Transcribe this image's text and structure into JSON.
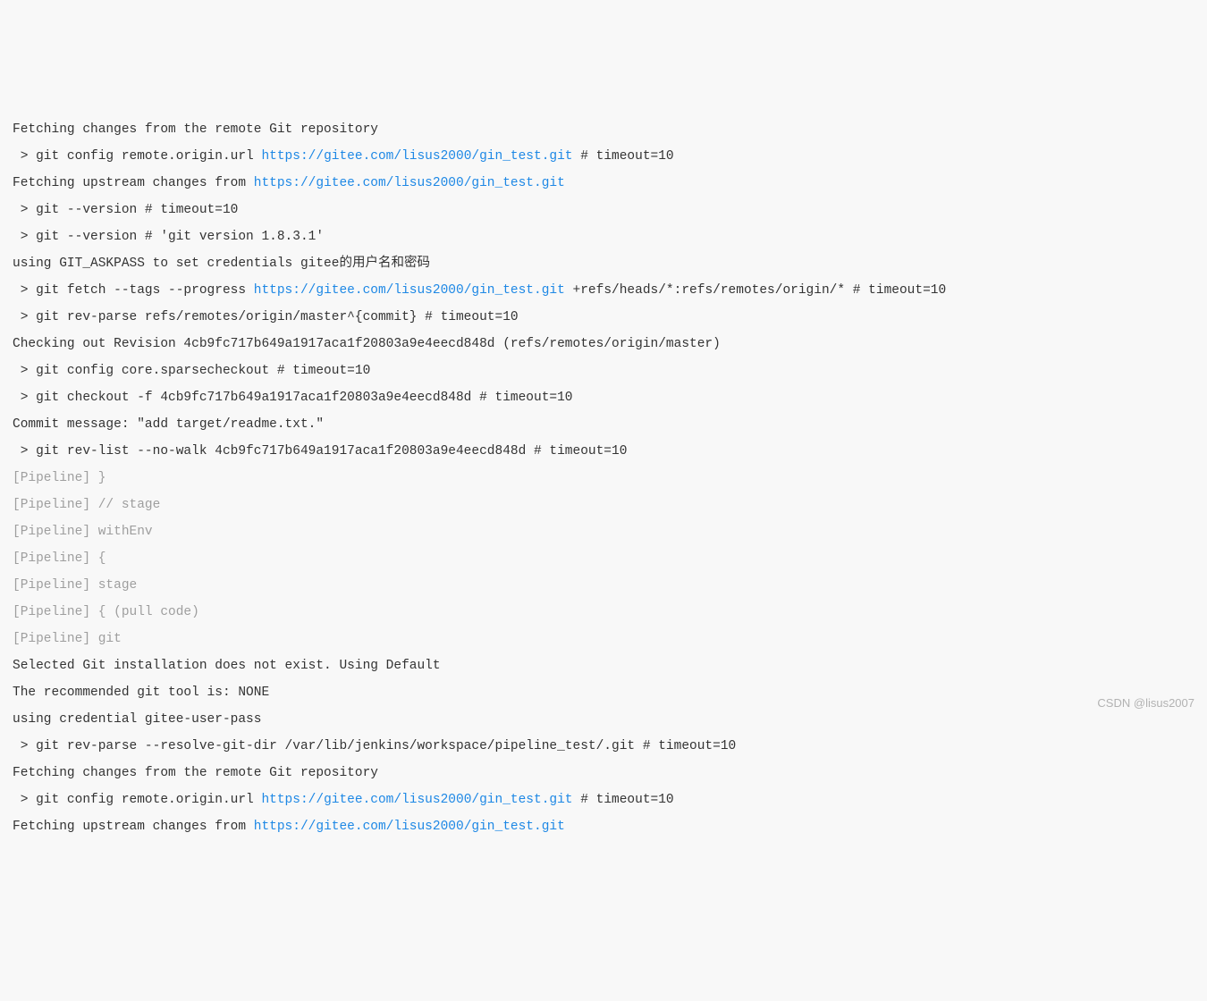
{
  "repo_url": "https://gitee.com/lisus2000/gin_test.git",
  "lines": [
    {
      "t": "plain",
      "text": "Fetching changes from the remote Git repository"
    },
    {
      "t": "cmd_link",
      "before": " > git config remote.origin.url ",
      "link": "https://gitee.com/lisus2000/gin_test.git",
      "after": " # timeout=10"
    },
    {
      "t": "link",
      "before": "Fetching upstream changes from ",
      "link": "https://gitee.com/lisus2000/gin_test.git",
      "after": ""
    },
    {
      "t": "plain",
      "text": " > git --version # timeout=10"
    },
    {
      "t": "plain",
      "text": " > git --version # 'git version 1.8.3.1'"
    },
    {
      "t": "plain",
      "text": "using GIT_ASKPASS to set credentials gitee的用户名和密码"
    },
    {
      "t": "cmd_link",
      "before": " > git fetch --tags --progress ",
      "link": "https://gitee.com/lisus2000/gin_test.git",
      "after": " +refs/heads/*:refs/remotes/origin/* # timeout=10"
    },
    {
      "t": "plain",
      "text": " > git rev-parse refs/remotes/origin/master^{commit} # timeout=10"
    },
    {
      "t": "plain",
      "text": "Checking out Revision 4cb9fc717b649a1917aca1f20803a9e4eecd848d (refs/remotes/origin/master)"
    },
    {
      "t": "plain",
      "text": " > git config core.sparsecheckout # timeout=10"
    },
    {
      "t": "plain",
      "text": " > git checkout -f 4cb9fc717b649a1917aca1f20803a9e4eecd848d # timeout=10"
    },
    {
      "t": "plain",
      "text": "Commit message: \"add target/readme.txt.\""
    },
    {
      "t": "plain",
      "text": " > git rev-list --no-walk 4cb9fc717b649a1917aca1f20803a9e4eecd848d # timeout=10"
    },
    {
      "t": "pipe",
      "text": "[Pipeline] }"
    },
    {
      "t": "pipe",
      "text": "[Pipeline] // stage"
    },
    {
      "t": "pipe",
      "text": "[Pipeline] withEnv"
    },
    {
      "t": "pipe",
      "text": "[Pipeline] {"
    },
    {
      "t": "pipe",
      "text": "[Pipeline] stage"
    },
    {
      "t": "pipe",
      "text": "[Pipeline] { (pull code)"
    },
    {
      "t": "pipe",
      "text": "[Pipeline] git"
    },
    {
      "t": "plain",
      "text": "Selected Git installation does not exist. Using Default"
    },
    {
      "t": "plain",
      "text": "The recommended git tool is: NONE"
    },
    {
      "t": "plain",
      "text": "using credential gitee-user-pass"
    },
    {
      "t": "plain",
      "text": " > git rev-parse --resolve-git-dir /var/lib/jenkins/workspace/pipeline_test/.git # timeout=10"
    },
    {
      "t": "plain",
      "text": "Fetching changes from the remote Git repository"
    },
    {
      "t": "cmd_link",
      "before": " > git config remote.origin.url ",
      "link": "https://gitee.com/lisus2000/gin_test.git",
      "after": " # timeout=10"
    },
    {
      "t": "link",
      "before": "Fetching upstream changes from ",
      "link": "https://gitee.com/lisus2000/gin_test.git",
      "after": ""
    }
  ],
  "watermark": "CSDN @lisus2007"
}
